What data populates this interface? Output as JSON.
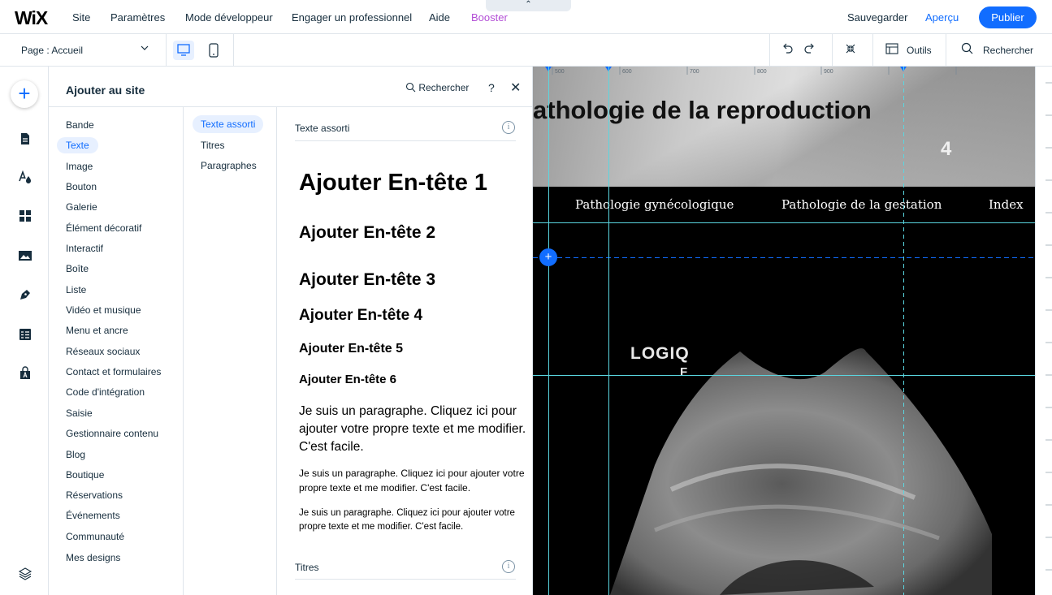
{
  "topbar": {
    "logo": "WiX",
    "menu": [
      "Site",
      "Paramètres",
      "Mode développeur",
      "Engager un professionnel",
      "Aide",
      "Booster"
    ],
    "collapse_glyph": "⌃",
    "save": "Sauvegarder",
    "preview": "Aperçu",
    "publish": "Publier"
  },
  "toolbar": {
    "page_select": "Page : Accueil",
    "tools_label": "Outils",
    "search_label": "Rechercher"
  },
  "rail": {
    "add_glyph": "+",
    "icons": [
      "add-icon",
      "pages-icon",
      "design-icon",
      "apps-icon",
      "media-icon",
      "blog-icon",
      "table-icon",
      "app-market-icon",
      "layers-icon"
    ]
  },
  "panel": {
    "title": "Ajouter au site",
    "search": "Rechercher",
    "help": "?",
    "close": "✕",
    "categories": [
      "Bande",
      "Texte",
      "Image",
      "Bouton",
      "Galerie",
      "Élément décoratif",
      "Interactif",
      "Boîte",
      "Liste",
      "Vidéo et musique",
      "Menu et ancre",
      "Réseaux sociaux",
      "Contact et formulaires",
      "Code d'intégration",
      "Saisie",
      "Gestionnaire contenu",
      "Blog",
      "Boutique",
      "Réservations",
      "Événements",
      "Communauté",
      "Mes designs"
    ],
    "active_category": "Texte",
    "subcategories": [
      "Texte assorti",
      "Titres",
      "Paragraphes"
    ],
    "active_subcategory": "Texte assorti",
    "section_title": "Texte assorti",
    "headings": [
      "Ajouter En-tête 1",
      "Ajouter En-tête 2",
      "Ajouter En-tête 3",
      "Ajouter En-tête 4",
      "Ajouter En-tête 5",
      "Ajouter En-tête 6"
    ],
    "paragraphs": [
      "Je suis un paragraphe. Cliquez ici pour ajouter votre propre texte et me modifier. C'est facile.",
      "Je suis un paragraphe. Cliquez ici pour ajouter votre propre texte et me modifier. C'est facile.",
      "Je suis un paragraphe. Cliquez ici pour ajouter votre propre texte et me modifier. C'est facile."
    ],
    "section2_title": "Titres",
    "info_glyph": "i"
  },
  "canvas": {
    "hero_title": "athologie de la reproduction",
    "hero_mark": "4",
    "nav": [
      "Pathologie gynécologique",
      "Pathologie de la gestation",
      "Index"
    ],
    "ruler": [
      "500",
      "600",
      "700",
      "800",
      "900"
    ],
    "image_text": "LOGIQ",
    "image_text2": "F",
    "add_glyph": "+"
  }
}
